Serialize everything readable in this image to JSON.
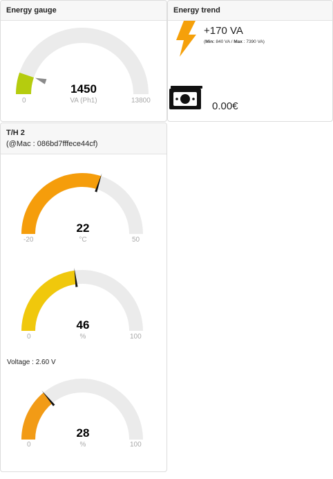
{
  "energy_gauge": {
    "title": "Energy gauge",
    "value": "1450",
    "unit": "VA (Ph1)",
    "min": "0",
    "max": "13800",
    "fraction": 0.105,
    "color": "#b5cc0e"
  },
  "energy_trend": {
    "title": "Energy trend",
    "value": "+170 VA",
    "min_label": "Min:",
    "min_value": "840 VA",
    "separator": " / ",
    "max_label": "Max",
    "max_value": ": 7390 VA",
    "cost": "0.00€",
    "bolt_color": "#f5a00a"
  },
  "th": {
    "title": "T/H 2",
    "mac": "(@Mac : 086bd7fffece44cf)",
    "voltage": "Voltage : 2.60 V",
    "gauges": [
      {
        "value": "22",
        "unit": "°C",
        "min": "-20",
        "max": "50",
        "fraction": 0.6,
        "color": "#f59d0b"
      },
      {
        "value": "46",
        "unit": "%",
        "min": "0",
        "max": "100",
        "fraction": 0.46,
        "color": "#f0c80c"
      },
      {
        "value": "28",
        "unit": "%",
        "min": "0",
        "max": "100",
        "fraction": 0.28,
        "color": "#f29b16"
      }
    ]
  },
  "colors": {
    "track": "#ebebeb",
    "needle": "#111111",
    "marker": "#8a8a8a"
  }
}
